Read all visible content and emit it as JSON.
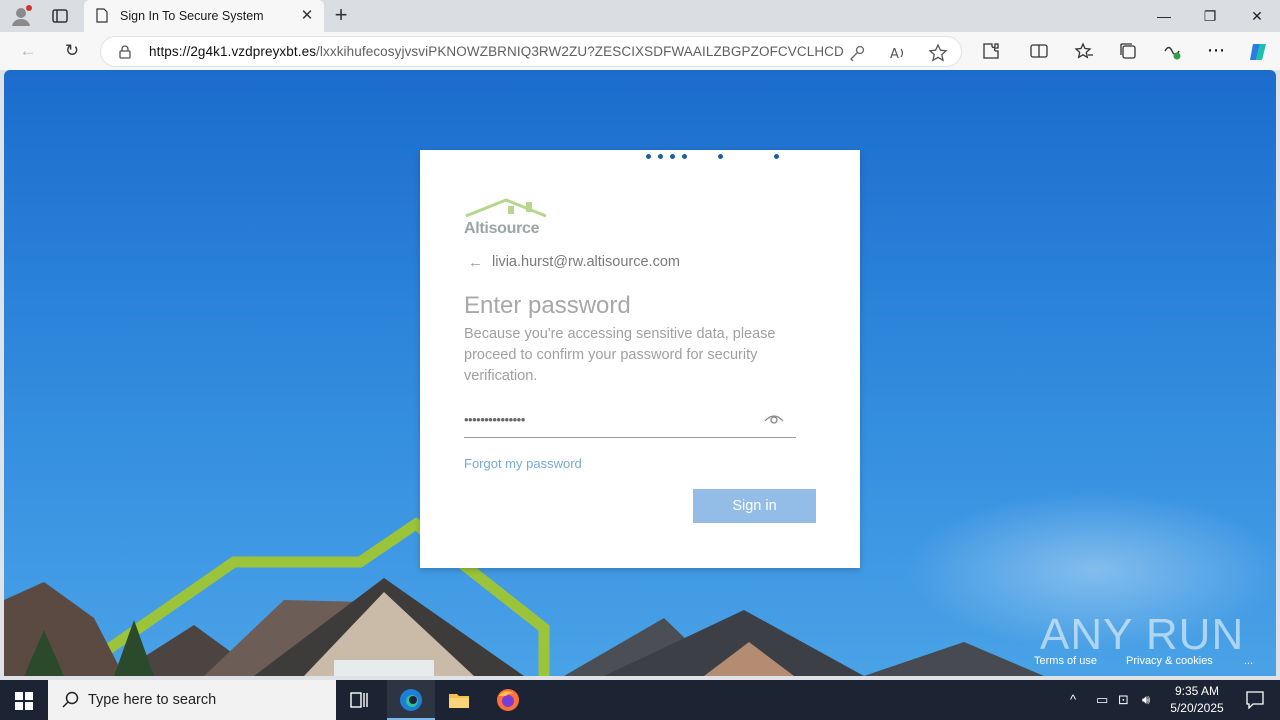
{
  "browser": {
    "tab_title": "Sign In To Secure System",
    "url_host": "https://2g4k1.vzdpreyxbt.es",
    "url_path": "/lxxkihufecosyjvsviPKNOWZBRNIQ3RW2ZU?ZESCIXSDFWAAILZBGPZOFCVCLHCD"
  },
  "login": {
    "brand": "Altisource",
    "email": "livia.hurst@rw.altisource.com",
    "heading": "Enter password",
    "description": "Because you're accessing sensitive data, please proceed to confirm your password for security verification.",
    "password_value": "•••••••••••••••",
    "forgot_link": "Forgot my password",
    "signin_button": "Sign in"
  },
  "footer": {
    "terms": "Terms of use",
    "privacy": "Privacy & cookies",
    "more": "..."
  },
  "watermark": "ANY RUN",
  "taskbar": {
    "search_placeholder": "Type here to search",
    "time": "9:35 AM",
    "date": "5/20/2025"
  },
  "colors": {
    "brand_green": "#9bc96a",
    "signin_blue": "#93bde6",
    "page_blue": "#2a81d8"
  }
}
